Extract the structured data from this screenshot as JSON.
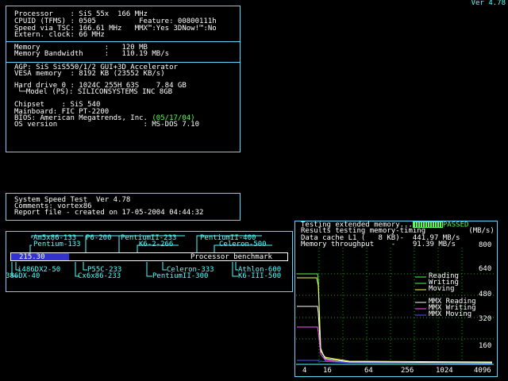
{
  "version": "Ver 4.78",
  "system_info": {
    "processor": "Processor    : SiS 55x  166 MHz",
    "cpuid": "CPUID (TFMS) : 0505          Feature: 00800111h",
    "speed_tsc": "Speed via TSC: 166.61 MHz   MMX™:Yes 3DNow!™:No",
    "ext_clock": "Extern. clock: 66 MHz",
    "memory": "Memory               :   120 MB",
    "mem_bandwidth": "Memory Bandwidth     :   110.19 MB/s",
    "agp": "AGP: SiS SiS550/1/2 GUI+3D Accelerator",
    "vesa": "VESA memory  : 8192 KB (23552 KB/s)",
    "hdd": "Hard drive 0 : 1024C 255H 63S    7.84 GB",
    "hdd_model": "└─Model (PS): SILICONSYSTEMS INC 8GB",
    "chipset": "Chipset    : SiS 540",
    "mainboard": "Mainboard: FIC PT-2200",
    "bios_label": "BIOS: American Megatrends, Inc. ",
    "bios_date": "(05/17/04)",
    "os": "OS version                    : MS-DOS 7.10"
  },
  "speed_test": {
    "title": "System Speed Test  Ver 4.78",
    "comments": "Comments: vortex86",
    "report": "Report file - created on 17-05-2004 04:44:32"
  },
  "benchmark": {
    "score": "215.30",
    "score_value": 215.3,
    "bar_fraction": 0.21,
    "label": "Processor benchmark",
    "top_labels": [
      "Am5x86-133",
      "P6-200",
      "PentiumII-233",
      "PentiumII-400",
      "Pentium-133",
      "K6-2-266",
      "Celeron-500"
    ],
    "bottom_labels": [
      "i486DX2-50",
      "386DX-40",
      "P55C-233",
      "Cx6x86-233",
      "Celeron-333",
      "PentiumII-300",
      "Athlon-600",
      "K6-III-500"
    ]
  },
  "memory_test": {
    "line1_prefix": "Testing extended memory...",
    "passed": "PASSED",
    "line2": "Results testing memory-timing          (MB/s)",
    "line3": "Data cache L1 (   8 KB)-  441.97 MB/s",
    "line4": "Memory throughput    -    91.39 MB/s",
    "y_ticks": [
      "800",
      "640",
      "480",
      "320",
      "160"
    ],
    "x_ticks": [
      "4",
      "16",
      "64",
      "256",
      "1024",
      "4096"
    ],
    "legend": [
      {
        "label": "Reading",
        "color": "#55ff55"
      },
      {
        "label": "Writing",
        "color": "#55ff55"
      },
      {
        "label": "Moving",
        "color": "#ffff55"
      },
      {
        "label": "MMX Reading",
        "color": "#ffffff"
      },
      {
        "label": "MMX Writing",
        "color": "#ff55ff"
      },
      {
        "label": "MMX Moving",
        "color": "#5555ff"
      }
    ]
  }
}
